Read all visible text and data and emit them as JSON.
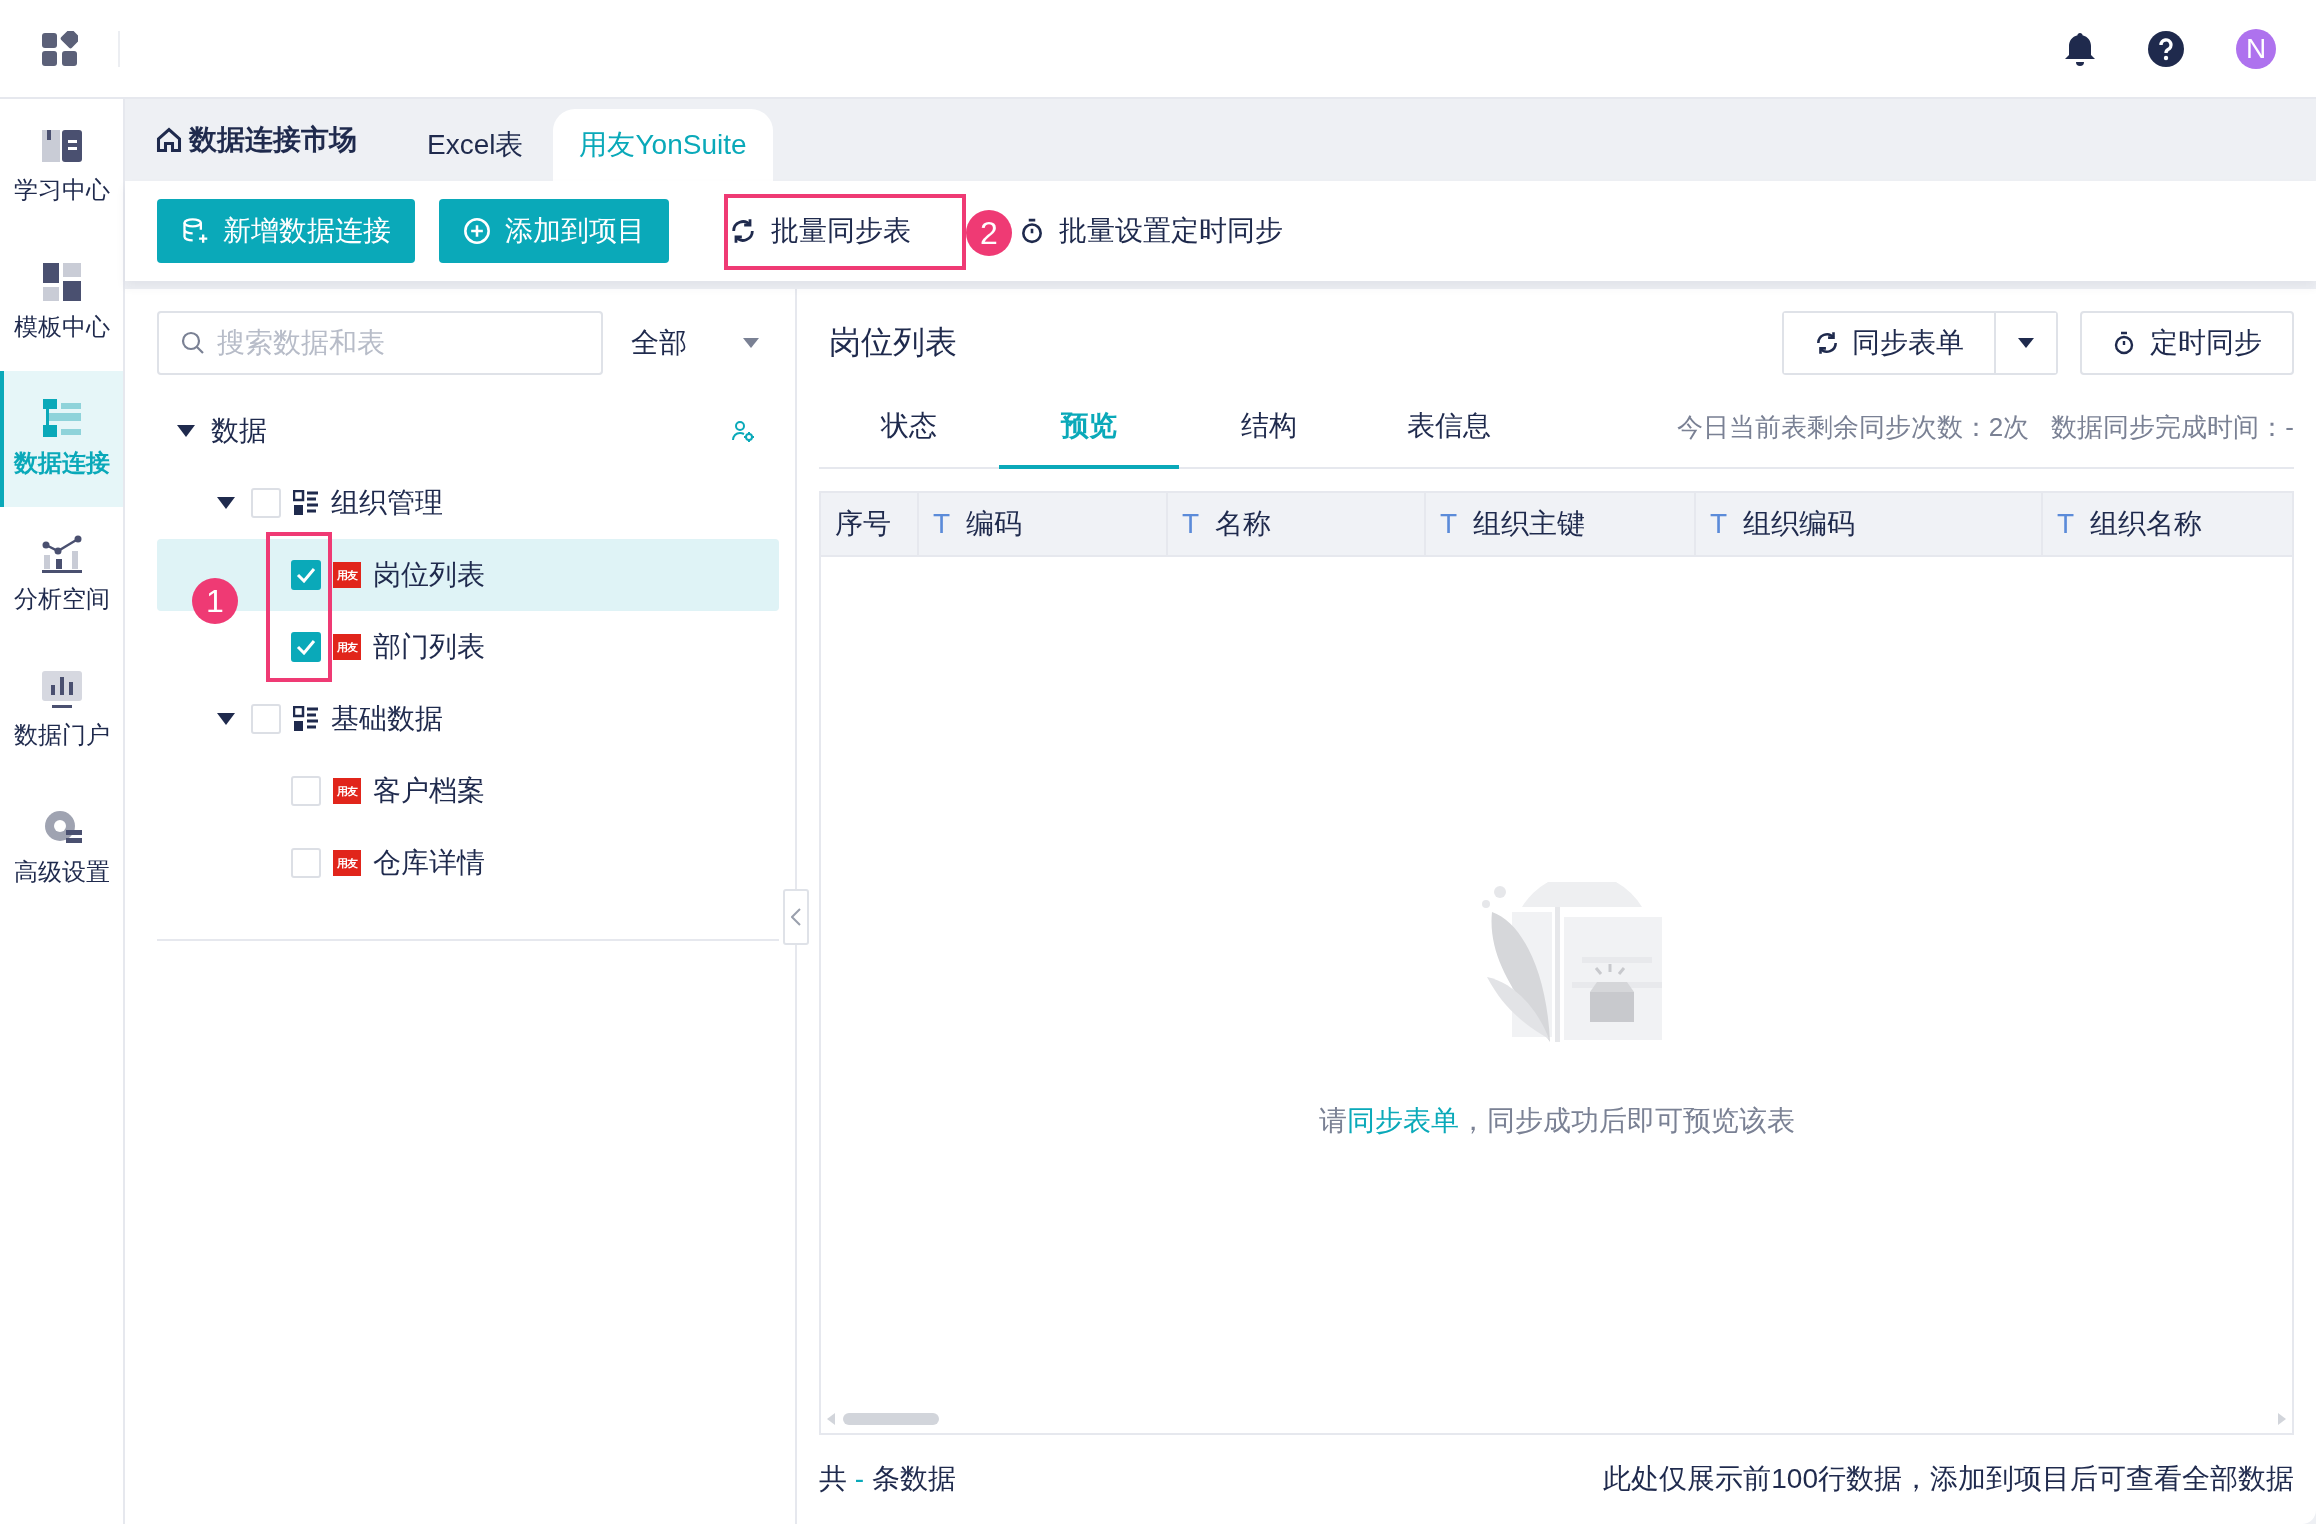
{
  "header": {
    "avatar": "N"
  },
  "sidebar": {
    "items": [
      {
        "label": "学习中心",
        "selected": false
      },
      {
        "label": "模板中心",
        "selected": false
      },
      {
        "label": "数据连接",
        "selected": true
      },
      {
        "label": "分析空间",
        "selected": false
      },
      {
        "label": "数据门户",
        "selected": false
      },
      {
        "label": "高级设置",
        "selected": false
      }
    ]
  },
  "breadcrumb": {
    "home": "数据连接市场"
  },
  "tabs": [
    {
      "label": "Excel表",
      "selected": false
    },
    {
      "label": "用友YonSuite",
      "selected": true
    }
  ],
  "toolbar": [
    {
      "label": "新增数据连接",
      "kind": "primary"
    },
    {
      "label": "添加到项目",
      "kind": "primary"
    },
    {
      "label": "批量同步表",
      "kind": "text"
    },
    {
      "label": "批量设置定时同步",
      "kind": "text"
    }
  ],
  "search": {
    "placeholder": "搜索数据和表"
  },
  "filter": {
    "value": "全部"
  },
  "tree": [
    {
      "label": "数据",
      "kind": "root",
      "expanded": true,
      "children": [
        {
          "label": "组织管理",
          "kind": "group",
          "expanded": true,
          "checked": false,
          "children": [
            {
              "label": "岗位列表",
              "kind": "table",
              "logo": "用友",
              "checked": true,
              "selected": true
            },
            {
              "label": "部门列表",
              "kind": "table",
              "logo": "用友",
              "checked": true,
              "selected": false
            }
          ]
        },
        {
          "label": "基础数据",
          "kind": "group",
          "expanded": true,
          "checked": false,
          "children": [
            {
              "label": "客户档案",
              "kind": "table",
              "logo": "用友",
              "checked": false,
              "selected": false
            },
            {
              "label": "仓库详情",
              "kind": "table",
              "logo": "用友",
              "checked": false,
              "selected": false
            }
          ]
        }
      ]
    }
  ],
  "detail": {
    "title": "岗位列表",
    "sync_button": "同步表单",
    "schedule_button": "定时同步",
    "tabs": [
      {
        "label": "状态",
        "selected": false
      },
      {
        "label": "预览",
        "selected": true
      },
      {
        "label": "结构",
        "selected": false
      },
      {
        "label": "表信息",
        "selected": false
      }
    ],
    "remaining": "今日当前表剩余同步次数：2次",
    "sync_time": "数据同步完成时间：-",
    "table": {
      "columns": [
        {
          "label": "序号",
          "kind": "index"
        },
        {
          "label": "编码",
          "kind": "text",
          "type_mark": "T"
        },
        {
          "label": "名称",
          "kind": "text",
          "type_mark": "T"
        },
        {
          "label": "组织主键",
          "kind": "text",
          "type_mark": "T"
        },
        {
          "label": "组织编码",
          "kind": "text",
          "type_mark": "T"
        },
        {
          "label": "组织名称",
          "kind": "text",
          "type_mark": "T"
        }
      ]
    },
    "empty": {
      "prefix": "请",
      "link": "同步表单",
      "suffix": "，同步成功后即可预览该表"
    },
    "footer": {
      "prefix": "共",
      "count": "-",
      "suffix": "条数据",
      "note": "此处仅展示前100行数据，添加到项目后可查看全部数据"
    }
  },
  "annotations": [
    {
      "label": "1"
    },
    {
      "label": "2"
    }
  ]
}
